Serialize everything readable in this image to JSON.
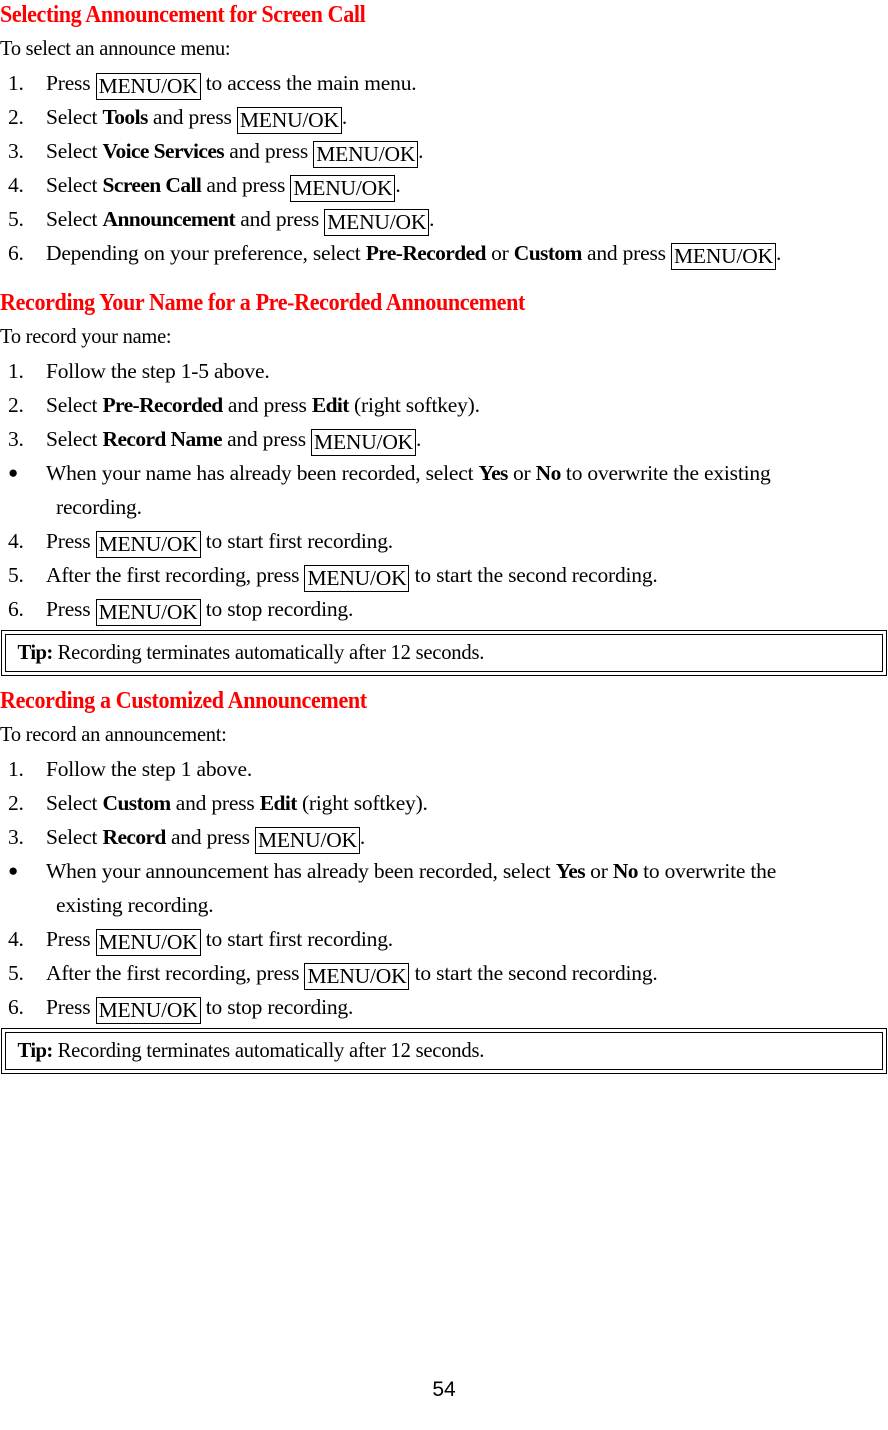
{
  "document": {
    "page_number": "54",
    "heading_color": "#FF0000",
    "text_color": "#000000"
  },
  "sections": [
    {
      "heading": "Selecting Announcement for Screen Call",
      "intro": "To select an announce menu:",
      "steps": [
        {
          "num": "1.",
          "parts": [
            {
              "t": "Press "
            },
            {
              "t": "MENU/OK",
              "k": true
            },
            {
              "t": " to access the main menu."
            }
          ]
        },
        {
          "num": "2.",
          "parts": [
            {
              "t": "Select "
            },
            {
              "t": "Tools",
              "b": true
            },
            {
              "t": " and press "
            },
            {
              "t": "MENU/OK",
              "k": true
            },
            {
              "t": "."
            }
          ]
        },
        {
          "num": "3.",
          "parts": [
            {
              "t": "Select "
            },
            {
              "t": "Voice Services",
              "b": true
            },
            {
              "t": " and press "
            },
            {
              "t": "MENU/OK",
              "k": true
            },
            {
              "t": "."
            }
          ]
        },
        {
          "num": "4.",
          "parts": [
            {
              "t": "Select "
            },
            {
              "t": "Screen Call",
              "b": true
            },
            {
              "t": " and press "
            },
            {
              "t": "MENU/OK",
              "k": true
            },
            {
              "t": "."
            }
          ]
        },
        {
          "num": "5.",
          "parts": [
            {
              "t": "Select "
            },
            {
              "t": "Announcement",
              "b": true
            },
            {
              "t": " and press "
            },
            {
              "t": "MENU/OK",
              "k": true
            },
            {
              "t": "."
            }
          ]
        },
        {
          "num": "6.",
          "parts": [
            {
              "t": "Depending on your preference, select "
            },
            {
              "t": "Pre-Recorded",
              "b": true
            },
            {
              "t": " or "
            },
            {
              "t": "Custom",
              "b": true
            },
            {
              "t": " and press "
            },
            {
              "t": "MENU/OK",
              "k": true
            },
            {
              "t": "."
            }
          ]
        }
      ],
      "tip": null
    },
    {
      "heading": "Recording Your Name for a Pre-Recorded Announcement",
      "intro": "To record your name:",
      "steps": [
        {
          "num": "1.",
          "parts": [
            {
              "t": "Follow the step 1-5 above."
            }
          ]
        },
        {
          "num": "2.",
          "parts": [
            {
              "t": "Select "
            },
            {
              "t": "Pre-Recorded",
              "b": true
            },
            {
              "t": " and press "
            },
            {
              "t": "Edit",
              "b": true
            },
            {
              "t": " (right softkey)."
            }
          ]
        },
        {
          "num": "3.",
          "parts": [
            {
              "t": "Select "
            },
            {
              "t": "Record Name",
              "b": true
            },
            {
              "t": " and press "
            },
            {
              "t": "MENU/OK",
              "k": true
            },
            {
              "t": "."
            }
          ]
        },
        {
          "bullet": true,
          "num": "●",
          "parts": [
            {
              "t": " When your name has already been recorded, select "
            },
            {
              "t": "Yes",
              "b": true
            },
            {
              "t": " or "
            },
            {
              "t": "No",
              "b": true
            },
            {
              "t": " to overwrite the existing"
            }
          ],
          "continuation": "recording."
        },
        {
          "num": "4.",
          "parts": [
            {
              "t": "Press "
            },
            {
              "t": "MENU/OK",
              "k": true
            },
            {
              "t": " to start first recording."
            }
          ]
        },
        {
          "num": "5.",
          "parts": [
            {
              "t": " After the first recording, press "
            },
            {
              "t": "MENU/OK",
              "k": true
            },
            {
              "t": " to start the second recording."
            }
          ]
        },
        {
          "num": "6.",
          "parts": [
            {
              "t": "Press "
            },
            {
              "t": "MENU/OK",
              "k": true
            },
            {
              "t": " to stop recording."
            }
          ]
        }
      ],
      "tip": {
        "label": "Tip:",
        "text": " Recording terminates automatically after 12 seconds."
      }
    },
    {
      "heading": "Recording a Customized Announcement",
      "intro": "To record an announcement:",
      "steps": [
        {
          "num": "1.",
          "parts": [
            {
              "t": "Follow the step 1 above."
            }
          ]
        },
        {
          "num": "2.",
          "parts": [
            {
              "t": "Select "
            },
            {
              "t": "Custom",
              "b": true
            },
            {
              "t": " and press "
            },
            {
              "t": "Edit",
              "b": true
            },
            {
              "t": " (right softkey)."
            }
          ]
        },
        {
          "num": "3.",
          "parts": [
            {
              "t": "Select "
            },
            {
              "t": "Record",
              "b": true
            },
            {
              "t": " and press "
            },
            {
              "t": "MENU/OK",
              "k": true
            },
            {
              "t": "."
            }
          ]
        },
        {
          "bullet": true,
          "num": "●",
          "parts": [
            {
              "t": " When your announcement has already been recorded, select "
            },
            {
              "t": "Yes",
              "b": true
            },
            {
              "t": " or "
            },
            {
              "t": "No",
              "b": true
            },
            {
              "t": " to overwrite the"
            }
          ],
          "continuation": "existing recording."
        },
        {
          "num": "4.",
          "parts": [
            {
              "t": "Press "
            },
            {
              "t": "MENU/OK",
              "k": true
            },
            {
              "t": " to start first recording."
            }
          ]
        },
        {
          "num": "5.",
          "parts": [
            {
              "t": "After the first recording, press "
            },
            {
              "t": "MENU/OK",
              "k": true
            },
            {
              "t": " to start the second recording."
            }
          ]
        },
        {
          "num": "6.",
          "parts": [
            {
              "t": "Press "
            },
            {
              "t": "MENU/OK",
              "k": true
            },
            {
              "t": " to stop recording."
            }
          ]
        }
      ],
      "tip": {
        "label": "Tip:",
        "text": " Recording terminates automatically after 12 seconds."
      }
    }
  ]
}
